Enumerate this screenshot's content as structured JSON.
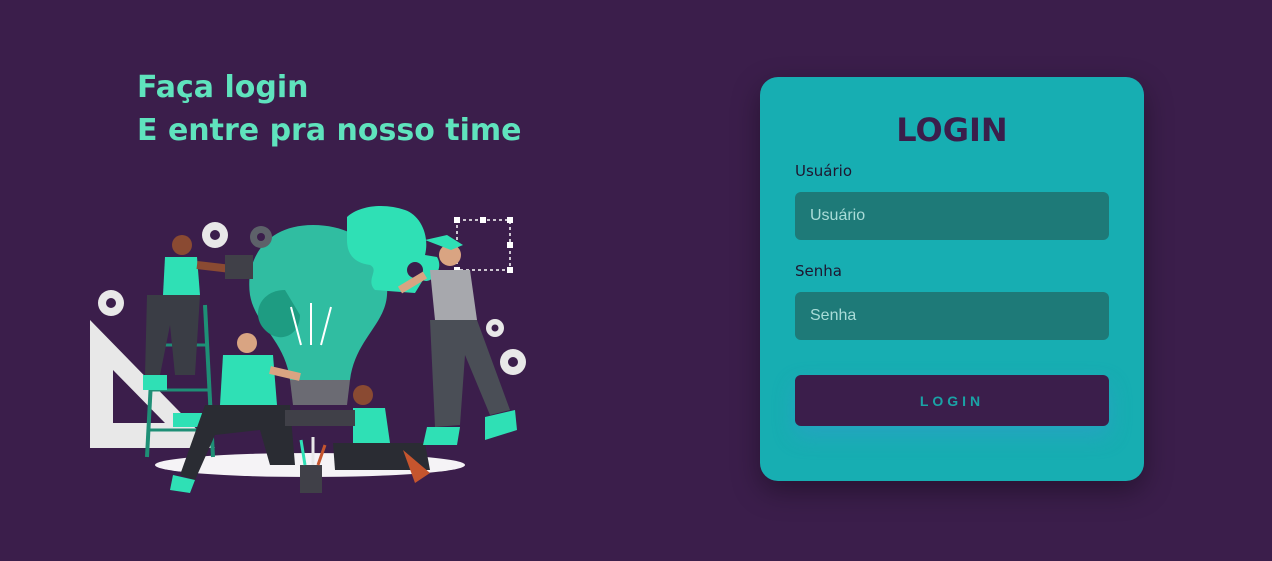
{
  "hero": {
    "line1": "Faça login",
    "line2": "E entre pra nosso time"
  },
  "login_card": {
    "title": "LOGIN",
    "username": {
      "label": "Usuário",
      "placeholder": "Usuário"
    },
    "password": {
      "label": "Senha",
      "placeholder": "Senha"
    },
    "submit_label": "LOGIN"
  },
  "colors": {
    "background": "#3b1e4b",
    "accent_green": "#5fe3bd",
    "card": "#17aeb2",
    "input": "#1e7a78"
  },
  "illustration": {
    "icon": "teamwork-lightbulb-puzzle-illustration"
  }
}
